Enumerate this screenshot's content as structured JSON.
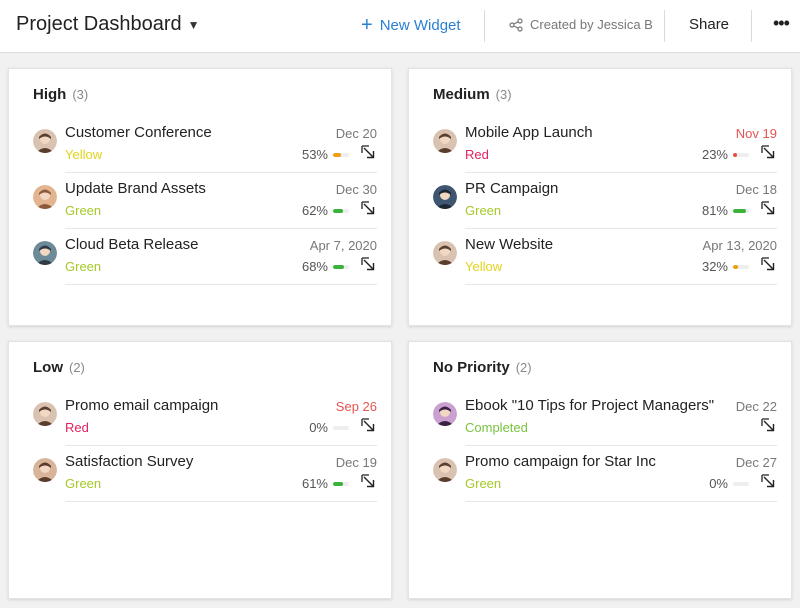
{
  "header": {
    "title": "Project Dashboard",
    "new_widget_label": "New Widget",
    "created_by": "Created by Jessica B",
    "share_label": "Share",
    "more_label": "•••"
  },
  "colors": {
    "accent": "#2a7fd4",
    "yellow": "#e3d21a",
    "green": "#a4c92a",
    "red": "#e0245e",
    "completed": "#7ac23f",
    "bar_orange": "#f39c12",
    "bar_green": "#3bb33b",
    "bar_red": "#e74c3c"
  },
  "cards": [
    {
      "title": "High",
      "count": "(3)",
      "rows": [
        {
          "name": "Customer Conference",
          "status": "Yellow",
          "status_class": "s-yellow",
          "date": "Dec 20",
          "overdue": false,
          "pct": "53%",
          "progress": 0.53,
          "bar_color": "#f39c12",
          "avatar": "a1"
        },
        {
          "name": "Update Brand Assets",
          "status": "Green",
          "status_class": "s-green",
          "date": "Dec 30",
          "overdue": false,
          "pct": "62%",
          "progress": 0.62,
          "bar_color": "#3bb33b",
          "avatar": "a2"
        },
        {
          "name": "Cloud Beta Release",
          "status": "Green",
          "status_class": "s-green",
          "date": "Apr 7, 2020",
          "overdue": false,
          "pct": "68%",
          "progress": 0.68,
          "bar_color": "#3bb33b",
          "avatar": "a3"
        }
      ]
    },
    {
      "title": "Medium",
      "count": "(3)",
      "rows": [
        {
          "name": "Mobile App Launch",
          "status": "Red",
          "status_class": "s-red",
          "date": "Nov 19",
          "overdue": true,
          "pct": "23%",
          "progress": 0.23,
          "bar_color": "#e74c3c",
          "avatar": "a1"
        },
        {
          "name": "PR Campaign",
          "status": "Green",
          "status_class": "s-green",
          "date": "Dec 18",
          "overdue": false,
          "pct": "81%",
          "progress": 0.81,
          "bar_color": "#3bb33b",
          "avatar": "a4"
        },
        {
          "name": "New Website",
          "status": "Yellow",
          "status_class": "s-yellow",
          "date": "Apr 13, 2020",
          "overdue": false,
          "pct": "32%",
          "progress": 0.32,
          "bar_color": "#f39c12",
          "avatar": "a1"
        }
      ]
    },
    {
      "title": "Low",
      "count": "(2)",
      "rows": [
        {
          "name": "Promo email campaign",
          "status": "Red",
          "status_class": "s-red",
          "date": "Sep 26",
          "overdue": true,
          "pct": "0%",
          "progress": 0,
          "bar_color": "#e74c3c",
          "avatar": "a1"
        },
        {
          "name": "Satisfaction Survey",
          "status": "Green",
          "status_class": "s-green",
          "date": "Dec 19",
          "overdue": false,
          "pct": "61%",
          "progress": 0.61,
          "bar_color": "#3bb33b",
          "avatar": "a5"
        }
      ]
    },
    {
      "title": "No Priority",
      "count": "(2)",
      "rows": [
        {
          "name": "Ebook \"10 Tips for Project Managers\"",
          "status": "Completed",
          "status_class": "s-completed",
          "date": "Dec 22",
          "overdue": false,
          "pct": "",
          "progress": null,
          "bar_color": "",
          "avatar": "a6"
        },
        {
          "name": "Promo campaign for Star Inc",
          "status": "Green",
          "status_class": "s-green",
          "date": "Dec 27",
          "overdue": false,
          "pct": "0%",
          "progress": 0,
          "bar_color": "#3bb33b",
          "avatar": "a1"
        }
      ]
    }
  ]
}
